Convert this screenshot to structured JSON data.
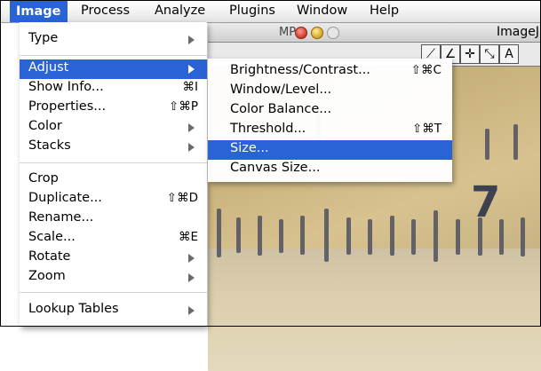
{
  "menubar": {
    "items": [
      "Image",
      "Process",
      "Analyze",
      "Plugins",
      "Window",
      "Help"
    ]
  },
  "imagej_window": {
    "title": "ImageJ",
    "mp_label": "MP",
    "tools": [
      "straight-line-tool",
      "angle-tool",
      "point-tool",
      "wand-tool",
      "text-tool"
    ],
    "tool_glyphs": [
      "⟋",
      "∠",
      "✛",
      "⤡",
      "A"
    ],
    "ruler_number": "7"
  },
  "image_menu": {
    "items": [
      {
        "label": "Type",
        "shortcut": "",
        "submenu": true
      },
      {
        "label": "Adjust",
        "shortcut": "",
        "submenu": true,
        "highlighted": true
      },
      {
        "label": "Show Info...",
        "shortcut": "⌘I",
        "submenu": false
      },
      {
        "label": "Properties...",
        "shortcut": "⇧⌘P",
        "submenu": false
      },
      {
        "label": "Color",
        "shortcut": "",
        "submenu": true
      },
      {
        "label": "Stacks",
        "shortcut": "",
        "submenu": true
      },
      {
        "label": "Crop",
        "shortcut": "",
        "submenu": false
      },
      {
        "label": "Duplicate...",
        "shortcut": "⇧⌘D",
        "submenu": false
      },
      {
        "label": "Rename...",
        "shortcut": "",
        "submenu": false
      },
      {
        "label": "Scale...",
        "shortcut": "⌘E",
        "submenu": false
      },
      {
        "label": "Rotate",
        "shortcut": "",
        "submenu": true
      },
      {
        "label": "Zoom",
        "shortcut": "",
        "submenu": true
      },
      {
        "label": "Lookup Tables",
        "shortcut": "",
        "submenu": true
      }
    ]
  },
  "adjust_submenu": {
    "items": [
      {
        "label": "Brightness/Contrast...",
        "shortcut": "⇧⌘C"
      },
      {
        "label": "Window/Level...",
        "shortcut": ""
      },
      {
        "label": "Color Balance...",
        "shortcut": ""
      },
      {
        "label": "Threshold...",
        "shortcut": "⇧⌘T"
      },
      {
        "label": "Size...",
        "shortcut": "",
        "highlighted": true
      },
      {
        "label": "Canvas Size...",
        "shortcut": ""
      }
    ]
  },
  "colors": {
    "highlight": "#2a63d6",
    "menu_bg": "#ffffff"
  }
}
